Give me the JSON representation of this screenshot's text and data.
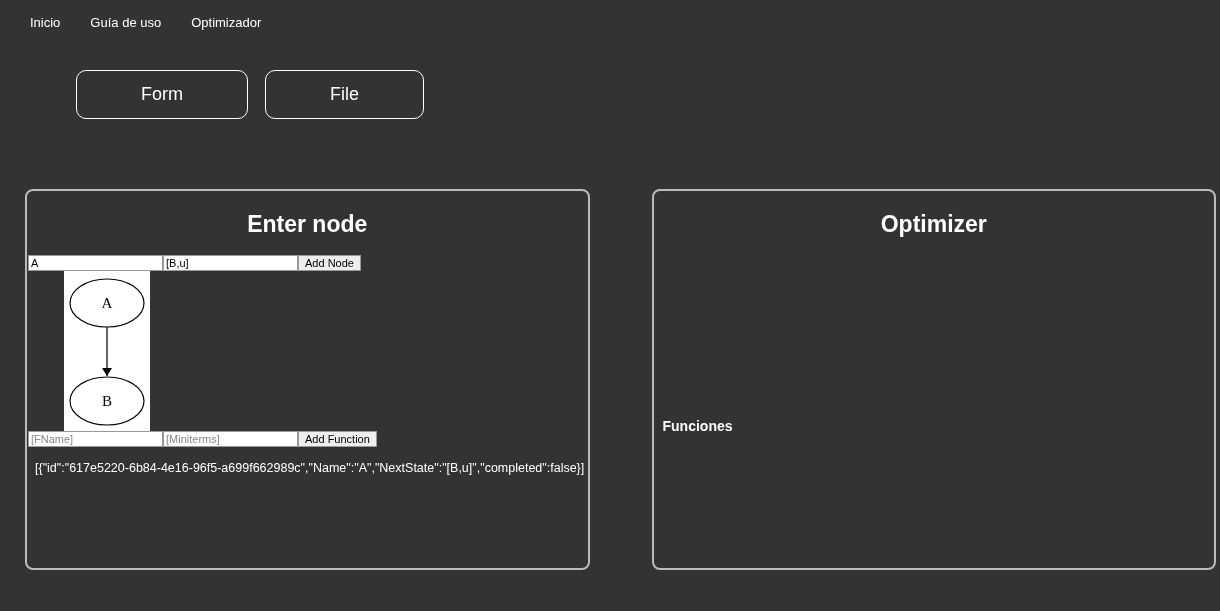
{
  "nav": {
    "items": [
      "Inicio",
      "Guía de uso",
      "Optimizador"
    ]
  },
  "mode_buttons": [
    "Form",
    "File"
  ],
  "node_panel": {
    "title": "Enter node",
    "node_form": {
      "name_value": "A",
      "next_state_value": "[B,u]",
      "button": "Add Node"
    },
    "graph": {
      "nodes": [
        "A",
        "B"
      ]
    },
    "function_form": {
      "name_placeholder": "[FName]",
      "miniterms_placeholder": "[Miniterms]",
      "button": "Add Function"
    },
    "output": "[{\"id\":\"617e5220-6b84-4e16-96f5-a699f662989c\",\"Name\":\"A\",\"NextState\":\"[B,u]\",\"completed\":false}]"
  },
  "optimizer_panel": {
    "title": "Optimizer",
    "functions_label": "Funciones"
  }
}
